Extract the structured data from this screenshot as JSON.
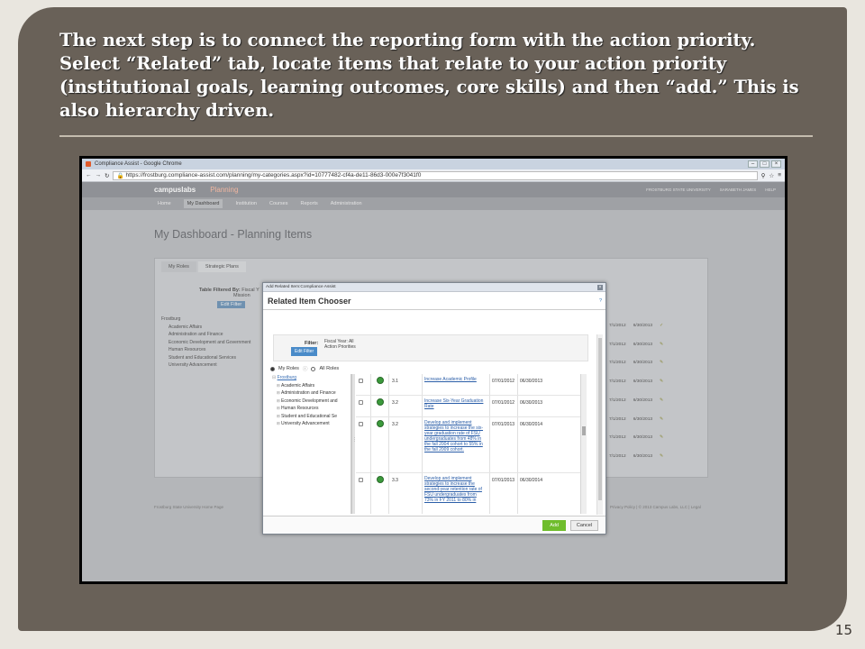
{
  "slide": {
    "title": "The next step is to connect the reporting form with the action priority.  Select “Related” tab, locate items that relate to your action priority (institutional goals, learning outcomes, core skills) and then “add.” This is also hierarchy driven.",
    "page_number": "15"
  },
  "browser": {
    "window_title": "Compliance Assist - Google Chrome",
    "url": "https://frostburg.compliance-assist.com/planning/my-categories.aspx?id=10777482-cf4a-de11-86d3-000e7f3041f0",
    "window_buttons": [
      "–",
      "□",
      "×"
    ]
  },
  "app": {
    "logo": "campuslabs",
    "product": "Planning",
    "university": "FROSTBURG STATE UNIVERSITY",
    "user": "SARABETH JAMES",
    "help": "HELP",
    "nav": [
      "Home",
      "My Dashboard",
      "Institution",
      "Courses",
      "Reports",
      "Administration"
    ],
    "page_heading": "My Dashboard - Planning Items",
    "tabs": [
      "My Roles",
      "Strategic Plans"
    ],
    "table_filtered_by": "Table Filtered By:",
    "filter_text": "Fiscal Y",
    "filter_text2": "Mission",
    "edit_filter": "Edit Filter",
    "tree": [
      "Frostburg",
      "Academic Affairs",
      "Administration and Finance",
      "Economic Development and Government",
      "Human Resources",
      "Student and Educational Services",
      "University Advancement"
    ],
    "rows": [
      {
        "start": "7/1/2012",
        "end": "6/30/2013"
      },
      {
        "start": "7/1/2012",
        "end": "6/30/2013"
      },
      {
        "start": "7/1/2012",
        "end": "6/30/2013"
      },
      {
        "start": "7/1/2012",
        "end": "6/30/2013"
      },
      {
        "start": "7/1/2012",
        "end": "6/30/2013"
      },
      {
        "start": "7/1/2012",
        "end": "6/30/2013"
      },
      {
        "start": "7/1/2012",
        "end": "6/30/2013"
      },
      {
        "start": "7/1/2012",
        "end": "6/30/2013"
      }
    ],
    "footer_left": "Frostburg State University Home Page",
    "footer_right": "Privacy Policy | © 2013 Campus Labs, LLC | Legal"
  },
  "modal": {
    "window_title": "Add Related Item:Compliance Assist",
    "heading": "Related Item Chooser",
    "help_link": "?",
    "filter_label": "Filter:",
    "filter_value_1": "Fiscal Year: All",
    "filter_value_2": "Action Priorities",
    "edit_filter": "Edit Filter",
    "roles_my": "My Roles",
    "roles_all": "All Roles",
    "tree_root": "Frostburg",
    "tree": [
      "Academic Affairs",
      "Administration and Finance",
      "Economic Development and",
      "Human Resources",
      "Student and Educational Se",
      "University Advancement"
    ],
    "items": [
      {
        "num": "3.1",
        "desc": "Increase Academic Profile",
        "start": "07/01/2012",
        "end": "06/30/2013"
      },
      {
        "num": "3.2",
        "desc": "Increase Six-Year Graduation Rate",
        "start": "07/01/2012",
        "end": "06/30/2013"
      },
      {
        "num": "3.2",
        "desc": "Develop and implement strategies to increase the six-year graduation rate of FSU undergraduates from 48% in the fall 2004 cohort to 55% in the fall 2009 cohort.",
        "start": "07/01/2013",
        "end": "06/30/2014"
      },
      {
        "num": "3.3",
        "desc": "Develop and implement strategies to increase the second-year retention rate of FSU undergraduates from 73% in FY 2011 to 80% in",
        "start": "07/01/2013",
        "end": "06/30/2014"
      }
    ],
    "add": "Add",
    "cancel": "Cancel"
  },
  "colors": {
    "frame": "#696158",
    "add_button": "#6fbd2c",
    "link": "#2b5ea8"
  }
}
